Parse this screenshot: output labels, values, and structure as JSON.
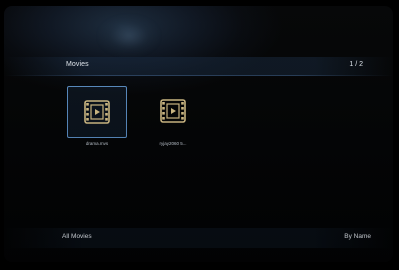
{
  "header": {
    "title": "Movies",
    "page_indicator": "1 / 2"
  },
  "items": [
    {
      "label": "drama.mvs",
      "icon": "film-icon",
      "selected": true
    },
    {
      "label": "ryjay2060 5...",
      "icon": "film-icon",
      "selected": false
    }
  ],
  "footer": {
    "filter_label": "All Movies",
    "sort_label": "By Name"
  },
  "colors": {
    "background": "#000000",
    "selection_border": "#5b8fc6",
    "icon_gold": "#d9c38a",
    "text": "#e8eef5"
  }
}
